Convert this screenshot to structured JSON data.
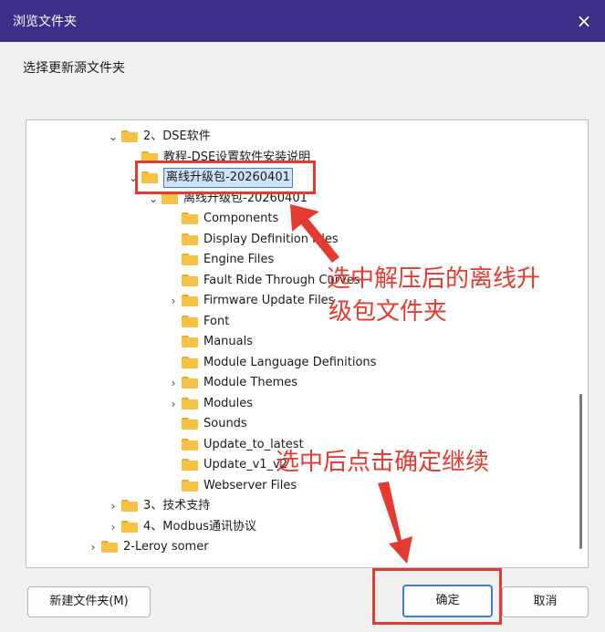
{
  "window": {
    "title": "浏览文件夹",
    "close_icon": "×"
  },
  "dialog": {
    "instruction": "选择更新源文件夹"
  },
  "tree": {
    "items": [
      {
        "label": "2、DSE软件",
        "depth": 0,
        "chevron": "expanded"
      },
      {
        "label": "教程-DSE设置软件安装说明",
        "depth": 1,
        "chevron": "none"
      },
      {
        "label": "离线升级包-20260401",
        "depth": 1,
        "chevron": "expanded",
        "selected": true
      },
      {
        "label": "离线升级包-20260401",
        "depth": 2,
        "chevron": "expanded"
      },
      {
        "label": "Components",
        "depth": 3,
        "chevron": "none"
      },
      {
        "label": "Display Definition Files",
        "depth": 3,
        "chevron": "none"
      },
      {
        "label": "Engine Files",
        "depth": 3,
        "chevron": "none"
      },
      {
        "label": "Fault Ride Through Curves",
        "depth": 3,
        "chevron": "none"
      },
      {
        "label": "Firmware Update Files",
        "depth": 3,
        "chevron": "collapsed"
      },
      {
        "label": "Font",
        "depth": 3,
        "chevron": "none"
      },
      {
        "label": "Manuals",
        "depth": 3,
        "chevron": "none"
      },
      {
        "label": "Module Language Definitions",
        "depth": 3,
        "chevron": "none"
      },
      {
        "label": "Module Themes",
        "depth": 3,
        "chevron": "collapsed"
      },
      {
        "label": "Modules",
        "depth": 3,
        "chevron": "collapsed"
      },
      {
        "label": "Sounds",
        "depth": 3,
        "chevron": "none"
      },
      {
        "label": "Update_to_latest",
        "depth": 3,
        "chevron": "none"
      },
      {
        "label": "Update_v1_v2",
        "depth": 3,
        "chevron": "none"
      },
      {
        "label": "Webserver Files",
        "depth": 3,
        "chevron": "none"
      },
      {
        "label": "3、技术支持",
        "depth": 0,
        "chevron": "collapsed"
      },
      {
        "label": "4、Modbus通讯协议",
        "depth": 0,
        "chevron": "collapsed"
      },
      {
        "label": "2-Leroy somer",
        "depth": -1,
        "chevron": "collapsed"
      }
    ]
  },
  "buttons": {
    "new_folder": "新建文件夹(M)",
    "ok": "确定",
    "cancel": "取消"
  },
  "annotations": {
    "note1_line1": "选中解压后的离线升",
    "note1_line2": "级包文件夹",
    "note2": "选中后点击确定继续"
  },
  "colors": {
    "titlebar": "#3b2f87",
    "annotation": "#e53a2f",
    "selection": "#cfe3f7"
  }
}
